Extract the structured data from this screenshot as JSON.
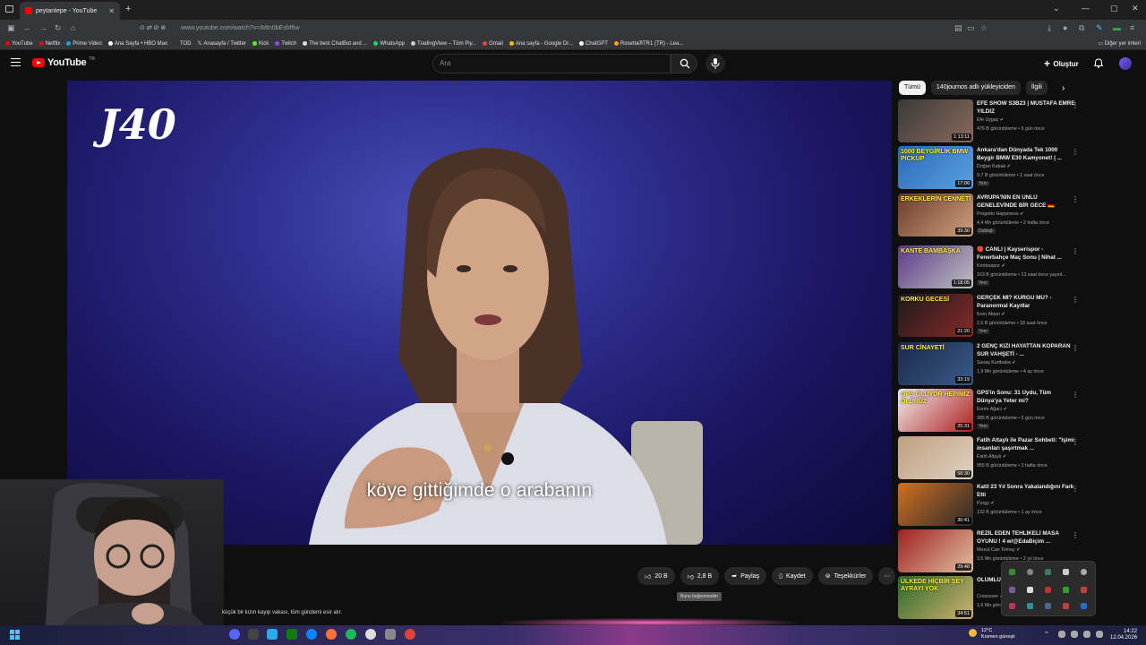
{
  "browser": {
    "tab_title": "peytantepe - YouTube",
    "url": "www.youtube.com/watch?v=iMtn0bEshf6w",
    "bookmarks": [
      "YouTube",
      "Netflix",
      "Prime Video",
      "Ana Sayfa • HBO Max",
      "TOD",
      "Anasayfa / Twitter",
      "Kick",
      "Twitch",
      "The best ChatBot and ...",
      "WhatsApp",
      "TradingView – Tüm Piy...",
      "Gmail",
      "Ana sayfa - Google Dr...",
      "ChatGPT",
      "Rosetta®TR1 (TR) - Lea..."
    ],
    "other_bookmarks": "Diğer yer imleri"
  },
  "header": {
    "logo_text": "YouTube",
    "logo_country": "TR",
    "search_placeholder": "Ara",
    "create_label": "Oluştur"
  },
  "video": {
    "channel_logo": "J40",
    "subtitle": "köye gittiğimde o arabanın"
  },
  "actions": {
    "like_count": "20 B",
    "dislike_count": "2,8 B",
    "share_label": "Paylaş",
    "save_label": "Kaydet",
    "thanks_label": "Teşekkürler",
    "tooltip": "Bunu beğenmedim"
  },
  "description_snippet": "küçük bir kızın kayıp vakası, tüm gündemi esir alır.",
  "sidebar": {
    "chips": [
      "Tümü",
      "140journos adlı yükleyiciden",
      "İlgili"
    ],
    "recommendations": [
      {
        "title": "EFE SHOW S3B23 | MUSTAFA EMRE YILDIZ",
        "channel": "Efe Uygaç",
        "meta": "476 B görüntüleme • 9 gün önce",
        "duration": "1:13:11",
        "badge": "",
        "thumb_text": "",
        "colors": [
          "#3a3a3a",
          "#8a6a5a"
        ]
      },
      {
        "title": "Ankara'dan Dünyada Tek 1000 Beygir BMW E30 Kamyonet! | ...",
        "channel": "Doğan Kabak",
        "meta": "9,7 B görüntüleme • 1 saat önce",
        "duration": "17:06",
        "badge": "Yeni",
        "thumb_text": "1000 BEYGİRLİK BMW PICKUP",
        "colors": [
          "#2a6ab8",
          "#5aa0e0"
        ]
      },
      {
        "title": "AVRUPA'NIN EN ÜNLÜ GENELEVİNDE BİR GECE 🇩🇪",
        "channel": "Progetto Happiness",
        "meta": "4,4 Mn görüntüleme • 2 hafta önce",
        "duration": "39:30",
        "badge": "Dublajlı",
        "thumb_text": "ERKEKLERİN CENNETİ",
        "colors": [
          "#6a3a2a",
          "#d0a080"
        ]
      },
      {
        "title": "🔴 CANLI | Kayserispor - Fenerbahçe Maç Sonu | Nihat ...",
        "channel": "Kontraspor",
        "meta": "163 B görüntüleme • 13 saat önce yayınl...",
        "duration": "1:18:05",
        "badge": "Yeni",
        "thumb_text": "KANTE BAMBAŞKA",
        "colors": [
          "#5a3a8a",
          "#c0c0c0"
        ]
      },
      {
        "title": "GERÇEK Mİ? KURGU MU? - Paranormal Kayıtlar",
        "channel": "Eren Aktan",
        "meta": "2,5 B görüntüleme • 18 saat önce",
        "duration": "21:20",
        "badge": "Yeni",
        "thumb_text": "KORKU GECESİ",
        "colors": [
          "#1a1a1a",
          "#8a2a2a"
        ]
      },
      {
        "title": "2 GENÇ KIZI HAYATTAN KOPARAN SUR VAHŞETİ - ...",
        "channel": "Savaş Kurtbaba",
        "meta": "1,9 Mn görüntüleme • 4 ay önce",
        "duration": "33:19",
        "badge": "",
        "thumb_text": "SUR CİNAYETİ",
        "colors": [
          "#1a2a4a",
          "#3a5a8a"
        ]
      },
      {
        "title": "GPS'in Sonu: 31 Uydu, Tüm Dünya'ya Yeter mi?",
        "channel": "Evrim Ağacı",
        "meta": "385 B görüntüleme • 2 gün önce",
        "duration": "25:31",
        "badge": "Yeni",
        "thumb_text": "GPS ÖLÜYOR HEPİMİZ ÖLÜRÜZ",
        "colors": [
          "#f0f0f0",
          "#b02020"
        ]
      },
      {
        "title": "Fatih Altaylı ile Pazar Sohbeti: \"İşimi insanları şaşırtmak ...",
        "channel": "Fatih Altaylı",
        "meta": "955 B görüntüleme • 2 hafta önce",
        "duration": "58:30",
        "badge": "",
        "thumb_text": "",
        "colors": [
          "#c0a080",
          "#e0d0c0"
        ]
      },
      {
        "title": "Katil 23 Yıl Sonra Yakalandığını Fark Etti",
        "channel": "Purgy",
        "meta": "132 B görüntüleme • 1 ay önce",
        "duration": "30:41",
        "badge": "",
        "thumb_text": "",
        "colors": [
          "#d07020",
          "#2a2a2a"
        ]
      },
      {
        "title": "REZİL EDEN TEHLİKELİ MASA OYUNU ! 4 w/@EdaBiçim ...",
        "channel": "Mesut Can Tomay",
        "meta": "3,5 Mn görüntüleme • 2 yıl önce",
        "duration": "29:48",
        "badge": "",
        "thumb_text": "",
        "colors": [
          "#a02020",
          "#e0c0a0"
        ]
      },
      {
        "title": "ÖLÜMLÜ",
        "channel": "Crossover",
        "meta": "1,6 Mn görüntüleme",
        "duration": "34:51",
        "badge": "",
        "thumb_text": "ÜLKEDE HİÇBİR ŞEY AYRAYI YOK",
        "colors": [
          "#2a6a2a",
          "#d0b070"
        ]
      }
    ]
  },
  "taskbar": {
    "weather_temp": "12°C",
    "weather_desc": "Kısmen güneşli",
    "time": "14:22",
    "date": "12.04.2026"
  }
}
